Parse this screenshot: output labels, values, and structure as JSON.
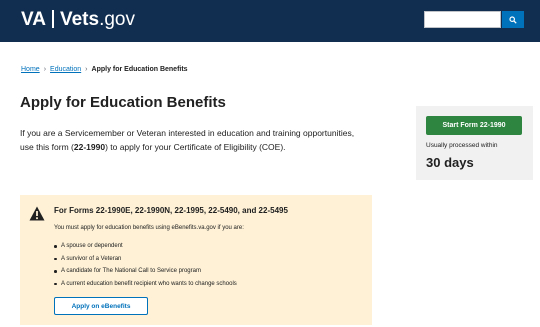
{
  "header": {
    "logo_va": "VA",
    "logo_site": "Vets",
    "logo_tld": ".gov",
    "search_placeholder": "",
    "background_color": "#112e51"
  },
  "breadcrumb": {
    "items": [
      "Home",
      "Education",
      "Apply for Education Benefits"
    ],
    "separator": "›"
  },
  "main": {
    "title": "Apply for Education Benefits",
    "intro_before": "If you are a Servicemember or Veteran interested in education and training opportunities, use this form (",
    "intro_form": "22-1990",
    "intro_after": ") to apply for your Certificate of Eligibility (COE)."
  },
  "sidebar": {
    "start_button": "Start Form 22-1990",
    "processed_label": "Usually processed within",
    "processed_value": "30 days",
    "button_color": "#2e8540"
  },
  "alert": {
    "heading": "For Forms 22-1990E, 22-1990N, 22-1995, 22-5490, and 22-5495",
    "text": "You must apply for education benefits using eBenefits.va.gov if you are:",
    "items": [
      "A spouse or dependent",
      "A survivor of a Veteran",
      "A candidate for The National Call to Service program",
      "A current education benefit recipient who wants to change schools"
    ],
    "button": "Apply on eBenefits",
    "icon": "warning-icon",
    "background_color": "#fef1d6"
  }
}
